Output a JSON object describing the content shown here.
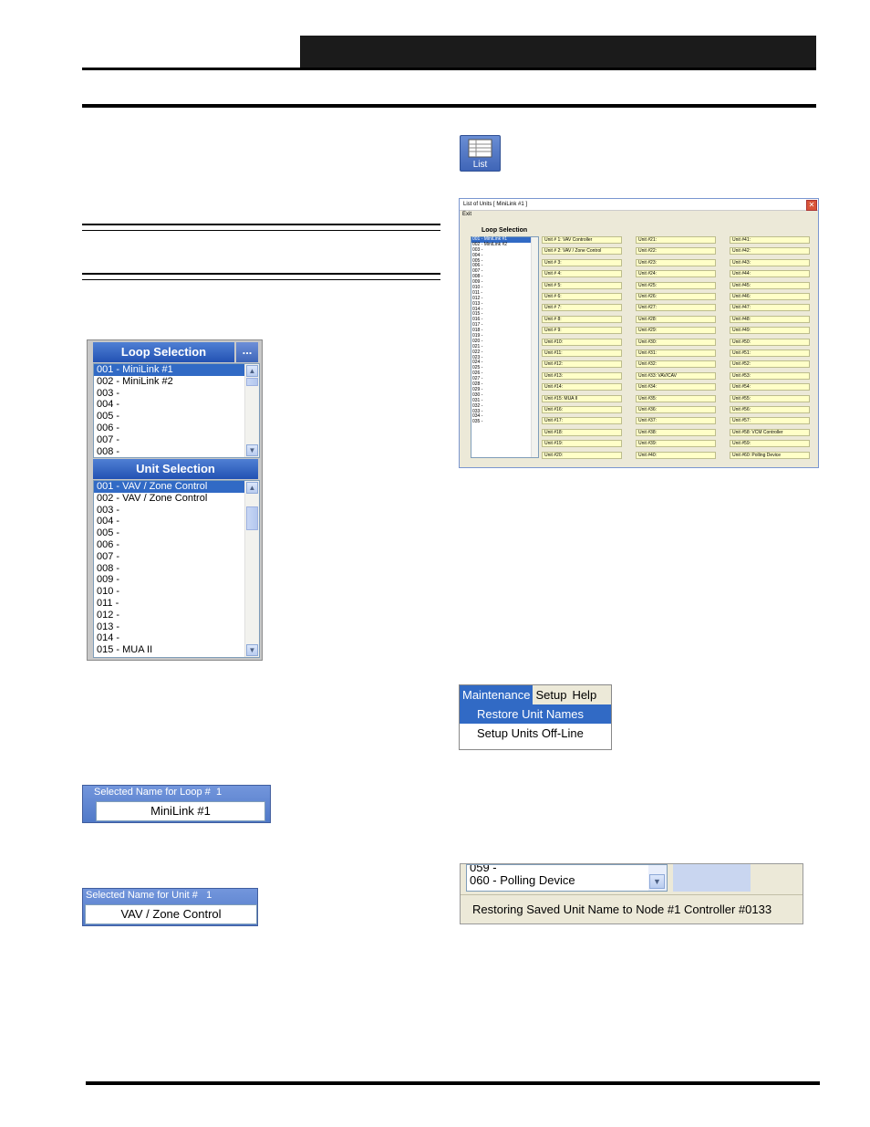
{
  "loop_selection": {
    "title": "Loop Selection",
    "ellipsis": "...",
    "items": [
      "001 - MiniLink #1",
      "002 - MiniLink #2",
      "003 -",
      "004 -",
      "005 -",
      "006 -",
      "007 -",
      "008 -"
    ]
  },
  "unit_selection": {
    "title": "Unit Selection",
    "items": [
      "001 - VAV / Zone Control",
      "002 - VAV / Zone Control",
      "003 -",
      "004 -",
      "005 -",
      "006 -",
      "007 -",
      "008 -",
      "009 -",
      "010 -",
      "011 -",
      "012 -",
      "013 -",
      "014 -",
      "015 - MUA II"
    ]
  },
  "loop_name": {
    "label": "Selected Name for Loop #",
    "number": "1",
    "value": "MiniLink #1"
  },
  "unit_name": {
    "label": "Selected Name for Unit #",
    "number": "1",
    "value": "VAV / Zone Control"
  },
  "list_icon": {
    "label": "List"
  },
  "list_window": {
    "title": "List of Units [ MiniLink #1 ]",
    "menu": "Exit",
    "loop_selection_label": "Loop Selection",
    "loop_items": [
      "001 - MiniLink #1",
      "002 - MiniLink #2",
      "003 -",
      "004 -",
      "005 -",
      "006 -",
      "007 -",
      "008 -",
      "009 -",
      "010 -",
      "011 -",
      "012 -",
      "013 -",
      "014 -",
      "015 -",
      "016 -",
      "017 -",
      "018 -",
      "019 -",
      "020 -",
      "021 -",
      "022 -",
      "023 -",
      "024 -",
      "025 -",
      "026 -",
      "027 -",
      "028 -",
      "029 -",
      "030 -",
      "031 -",
      "032 -",
      "033 -",
      "034 -",
      "035 -"
    ],
    "col1": [
      "Unit # 1:  VAV Controller",
      "Unit # 2:  VAV / Zone Control",
      "Unit # 3:",
      "Unit # 4:",
      "Unit # 5:",
      "Unit # 6:",
      "Unit # 7:",
      "Unit # 8:",
      "Unit # 9:",
      "Unit #10:",
      "Unit #11:",
      "Unit #12:",
      "Unit #13:",
      "Unit #14:",
      "Unit #15:  MUA II",
      "Unit #16:",
      "Unit #17:",
      "Unit #18:",
      "Unit #19:",
      "Unit #20:"
    ],
    "col2": [
      "Unit #21:",
      "Unit #22:",
      "Unit #23:",
      "Unit #24:",
      "Unit #25:",
      "Unit #26:",
      "Unit #27:",
      "Unit #28:",
      "Unit #29:",
      "Unit #30:",
      "Unit #31:",
      "Unit #32:",
      "Unit #33:  VAV/CAV",
      "Unit #34:",
      "Unit #35:",
      "Unit #36:",
      "Unit #37:",
      "Unit #38:",
      "Unit #39:",
      "Unit #40:"
    ],
    "col3": [
      "Unit #41:",
      "Unit #42:",
      "Unit #43:",
      "Unit #44:",
      "Unit #45:",
      "Unit #46:",
      "Unit #47:",
      "Unit #48:",
      "Unit #49:",
      "Unit #50:",
      "Unit #51:",
      "Unit #52:",
      "Unit #53:",
      "Unit #54:",
      "Unit #55:",
      "Unit #56:",
      "Unit #57:",
      "Unit #58:  VCM Controller",
      "Unit #59:",
      "Unit #60:  Polling Device"
    ]
  },
  "menu": {
    "bar": [
      "Maintenance",
      "Setup",
      "Help"
    ],
    "items": [
      "Restore Unit Names",
      "Setup Units Off-Line"
    ]
  },
  "status": {
    "list_items": [
      "059 -",
      "060 - Polling Device"
    ],
    "message": "Restoring Saved Unit Name to Node #1 Controller #0133"
  }
}
